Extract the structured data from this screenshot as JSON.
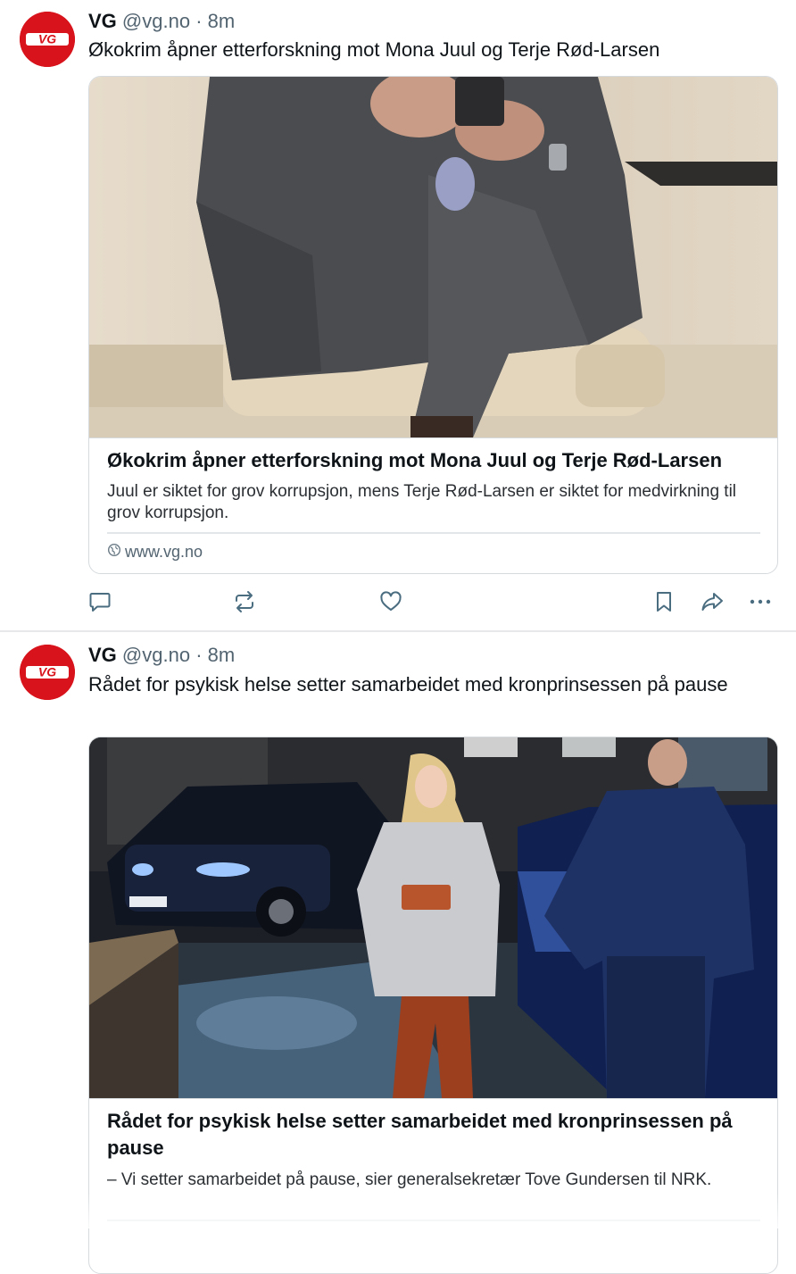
{
  "posts": [
    {
      "author": "VG",
      "handle": "@vg.no",
      "separator": "·",
      "time": "8m",
      "avatar_text": "VG",
      "text": "Økokrim åpner etterforskning mot Mona Juul og Terje Rød-Larsen",
      "card": {
        "title": "Økokrim åpner etterforskning mot Mona Juul og Terje Rød-Larsen",
        "description": "Juul er siktet for grov korrupsjon, mens Terje Rød-Larsen er siktet for medvirkning til grov korrupsjon.",
        "domain": "www.vg.no"
      }
    },
    {
      "author": "VG",
      "handle": "@vg.no",
      "separator": "·",
      "time": "8m",
      "avatar_text": "VG",
      "text": "Rådet for psykisk helse setter samarbeidet med kronprinsessen på pause",
      "card": {
        "title": "Rådet for psykisk helse setter samarbeidet med kronprinsessen på pause",
        "description": "– Vi setter samarbeidet på pause, sier generalsekretær Tove Gundersen til NRK."
      }
    }
  ],
  "action_icons": [
    "reply-icon",
    "repost-icon",
    "like-icon",
    "bookmark-icon",
    "share-icon",
    "more-icon"
  ],
  "colors": {
    "brand_red": "#d8131b",
    "text": "#0f1419",
    "meta": "#536471",
    "icon": "#4b6d80",
    "border": "#d6dadd"
  }
}
